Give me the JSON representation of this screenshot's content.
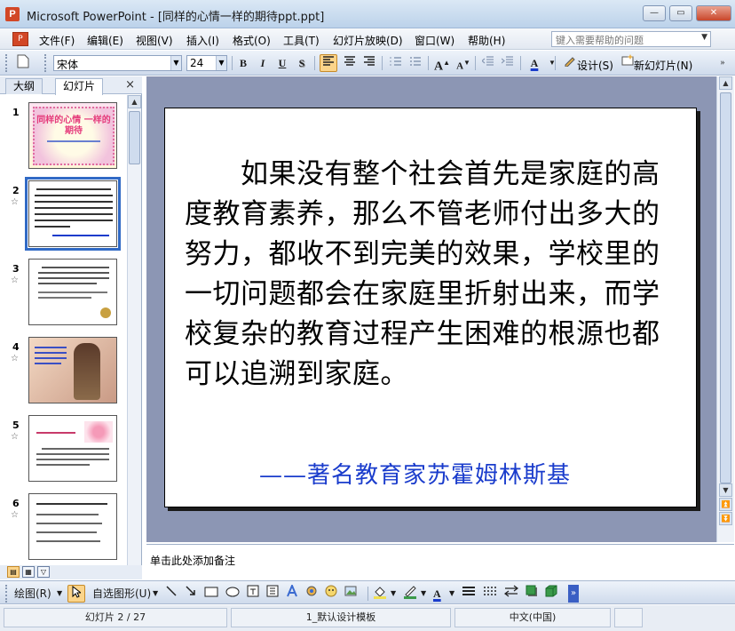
{
  "window": {
    "title": "Microsoft PowerPoint - [同样的心情一样的期待ppt.ppt]",
    "app_icon": "P",
    "controls": {
      "minimize": "—",
      "restore": "▭",
      "close": "✕"
    }
  },
  "menubar": {
    "items": [
      "文件(F)",
      "编辑(E)",
      "视图(V)",
      "插入(I)",
      "格式(O)",
      "工具(T)",
      "幻灯片放映(D)",
      "窗口(W)",
      "帮助(H)"
    ],
    "help_placeholder": "键入需要帮助的问题"
  },
  "toolbar": {
    "font_name": "宋体",
    "font_size": "24",
    "bold": "B",
    "italic": "I",
    "underline": "U",
    "shadow": "S",
    "grow_font": "A",
    "shrink_font": "A",
    "font_color": "A",
    "design_label": "设计(S)",
    "new_slide_label": "新幻灯片(N)"
  },
  "left_panel": {
    "tabs": [
      "大纲",
      "幻灯片"
    ],
    "close": "×",
    "slides": [
      {
        "num": "1",
        "starred": false,
        "selected": false
      },
      {
        "num": "2",
        "starred": true,
        "selected": true
      },
      {
        "num": "3",
        "starred": true,
        "selected": false
      },
      {
        "num": "4",
        "starred": true,
        "selected": false
      },
      {
        "num": "5",
        "starred": true,
        "selected": false
      },
      {
        "num": "6",
        "starred": true,
        "selected": false
      }
    ],
    "thumb1_title": "同样的心情 一样的期待"
  },
  "slide": {
    "body": "　　如果没有整个社会首先是家庭的高度教育素养，那么不管老师付出多大的努力，都收不到完美的效果，学校里的一切问题都会在家庭里折射出来，而学校复杂的教育过程产生困难的根源也都可以追溯到家庭。",
    "attribution": "——著名教育家苏霍姆林斯基",
    "attribution_color": "#1a3ccc"
  },
  "notes": {
    "placeholder": "单击此处添加备注"
  },
  "drawbar": {
    "draw_label": "绘图(R)",
    "autoshapes_label": "自选图形(U)"
  },
  "statusbar": {
    "slide_pos": "幻灯片 2 / 27",
    "template": "1_默认设计模板",
    "language": "中文(中国)"
  },
  "colors": {
    "selection": "#316ac5",
    "active_button": "#fbd48a",
    "workspace": "#8c96b4"
  }
}
